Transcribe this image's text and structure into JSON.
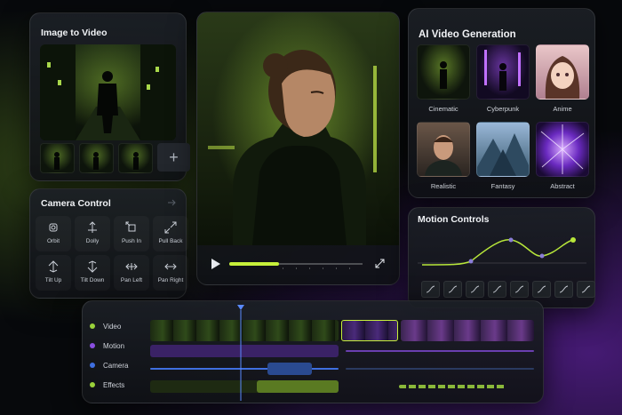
{
  "image_to_video": {
    "title": "Image to Video",
    "add_icon": "plus-icon",
    "add_label": "+"
  },
  "camera_control": {
    "title": "Camera Control",
    "buttons": [
      {
        "label": "Orbit",
        "icon": "orbit-icon"
      },
      {
        "label": "Dolly",
        "icon": "dolly-icon"
      },
      {
        "label": "Push In",
        "icon": "push-in-icon"
      },
      {
        "label": "Pull Back",
        "icon": "pull-back-icon"
      },
      {
        "label": "Tilt Up",
        "icon": "tilt-up-icon"
      },
      {
        "label": "Tilt Down",
        "icon": "tilt-down-icon"
      },
      {
        "label": "Pan Left",
        "icon": "pan-left-icon"
      },
      {
        "label": "Pan Right",
        "icon": "pan-right-icon"
      }
    ]
  },
  "player": {
    "play_icon": "play-icon",
    "fullscreen_icon": "fullscreen-icon",
    "progress": 0.37
  },
  "ai_generation": {
    "title": "AI Video Generation",
    "styles": [
      {
        "label": "Cinematic",
        "color": "#5f8f2a"
      },
      {
        "label": "Cyberpunk",
        "color": "#7a3fd0"
      },
      {
        "label": "Anime",
        "color": "#c98a9a"
      },
      {
        "label": "Realistic",
        "color": "#8a7060"
      },
      {
        "label": "Fantasy",
        "color": "#5a84a8"
      },
      {
        "label": "Abstract",
        "color": "#8a3fe0"
      }
    ]
  },
  "motion_controls": {
    "title": "Motion Controls",
    "curve_color": "#b7e63a",
    "keyframe_count": 8
  },
  "timeline": {
    "tracks": [
      {
        "label": "Video",
        "color": "#9ad13a"
      },
      {
        "label": "Motion",
        "color": "#8a4fe0"
      },
      {
        "label": "Camera",
        "color": "#3f6fe0"
      },
      {
        "label": "Effects",
        "color": "#9ad13a"
      }
    ],
    "accent": "#c6f03a"
  }
}
